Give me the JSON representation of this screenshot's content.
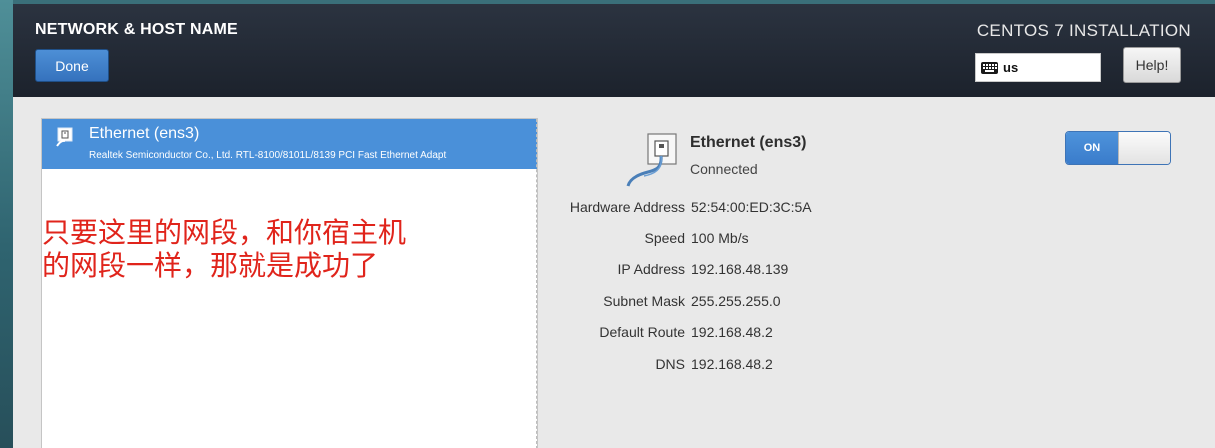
{
  "header": {
    "title": "NETWORK & HOST NAME",
    "done_label": "Done",
    "installer_title": "CENTOS 7 INSTALLATION",
    "keyboard_layout": "us",
    "help_label": "Help!"
  },
  "device_list": {
    "items": [
      {
        "name": "Ethernet (ens3)",
        "description": "Realtek Semiconductor Co., Ltd. RTL-8100/8101L/8139 PCI Fast Ethernet Adapt",
        "selected": true
      }
    ]
  },
  "annotation": {
    "line1": "只要这里的网段，和你宿主机",
    "line2": "的网段一样，那就是成功了"
  },
  "details": {
    "name": "Ethernet (ens3)",
    "status": "Connected",
    "toggle_label": "ON",
    "toggle_state": true,
    "properties": [
      {
        "label": "Hardware Address",
        "value": "52:54:00:ED:3C:5A"
      },
      {
        "label": "Speed",
        "value": "100 Mb/s"
      },
      {
        "label": "IP Address",
        "value": "192.168.48.139"
      },
      {
        "label": "Subnet Mask",
        "value": "255.255.255.0"
      },
      {
        "label": "Default Route",
        "value": "192.168.48.2"
      },
      {
        "label": "DNS",
        "value": "192.168.48.2"
      }
    ]
  },
  "colors": {
    "header_bg": "#1f2630",
    "accent_blue": "#4a90d9",
    "annotation_red": "#e0241b"
  },
  "icons": {
    "keyboard": "keyboard-icon",
    "network_device": "ethernet-icon"
  }
}
